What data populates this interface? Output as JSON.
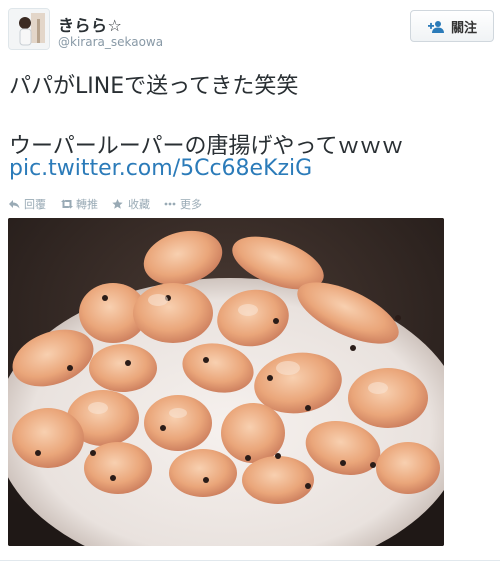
{
  "user": {
    "display_name": "きらら☆",
    "handle": "@kirara_sekaowa",
    "avatar_icon": "user-avatar"
  },
  "follow": {
    "label": "關注",
    "icon": "add-user-icon",
    "accent": "#2b7bb9"
  },
  "tweet": {
    "line1": "パパがLINEで送ってきた笑笑",
    "line2": "ウーパールーパーの唐揚げやってｗｗｗ",
    "link": "pic.twitter.com/5Cc68eKziG",
    "link_color": "#2b7bb9"
  },
  "actions": [
    {
      "label": "回覆",
      "icon": "reply-icon"
    },
    {
      "label": "轉推",
      "icon": "retweet-icon"
    },
    {
      "label": "收藏",
      "icon": "favorite-star-icon"
    },
    {
      "label": "更多",
      "icon": "more-dots-icon"
    }
  ],
  "media": {
    "description_icon": "fried-axolotl-photo"
  }
}
